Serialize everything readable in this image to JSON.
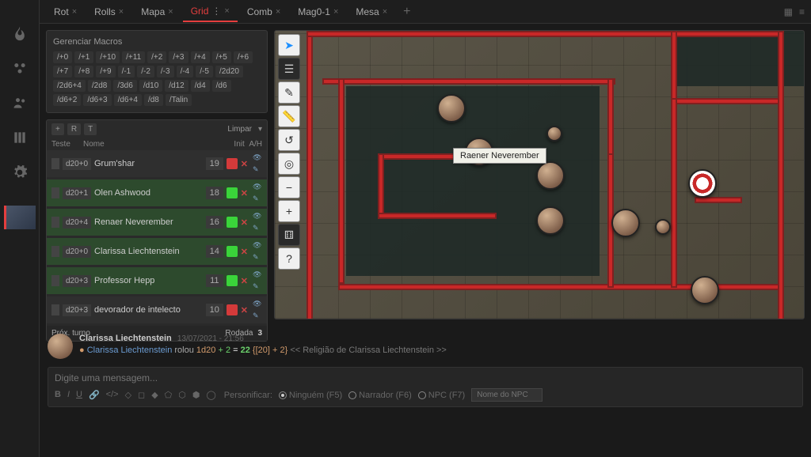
{
  "tabs": [
    "Rot",
    "Rolls",
    "Mapa",
    "Grid",
    "Comb",
    "Mag0-1",
    "Mesa"
  ],
  "activeTab": 3,
  "macros": {
    "title": "Gerenciar Macros",
    "items": [
      "/+0",
      "/+1",
      "/+10",
      "/+11",
      "/+2",
      "/+3",
      "/+4",
      "/+5",
      "/+6",
      "/+7",
      "/+8",
      "/+9",
      "/-1",
      "/-2",
      "/-3",
      "/-4",
      "/-5",
      "/2d20",
      "/2d6+4",
      "/2d8",
      "/3d6",
      "/d10",
      "/d12",
      "/d4",
      "/d6",
      "/d6+2",
      "/d6+3",
      "/d6+4",
      "/d8",
      "/Talin"
    ]
  },
  "initiative": {
    "buttons": {
      "r": "R",
      "t": "T",
      "clear": "Limpar"
    },
    "cols": {
      "test": "Teste",
      "name": "Nome",
      "init": "Init",
      "ah": "A/H"
    },
    "rows": [
      {
        "test": "d20+0",
        "name": "Grum'shar",
        "init": "19",
        "color": "#d43a3a",
        "player": false
      },
      {
        "test": "d20+1",
        "name": "Olen Ashwood",
        "init": "18",
        "color": "#3ad43a",
        "player": true
      },
      {
        "test": "d20+4",
        "name": "Renaer Neverember",
        "init": "16",
        "color": "#3ad43a",
        "player": true
      },
      {
        "test": "d20+0",
        "name": "Clarissa Liechtenstein",
        "init": "14",
        "color": "#3ad43a",
        "player": true
      },
      {
        "test": "d20+3",
        "name": "Professor Hepp",
        "init": "11",
        "color": "#3ad43a",
        "player": true
      },
      {
        "test": "d20+3",
        "name": "devorador de intelecto",
        "init": "10",
        "color": "#d43a3a",
        "player": false
      }
    ],
    "footer": {
      "next": "Próx. turno",
      "roundLabel": "Rodada",
      "round": "3"
    }
  },
  "map": {
    "tooltip": "Raener Neverember"
  },
  "chat": {
    "message": {
      "author": "Clarissa Liechtenstein",
      "ts": "13/07/2021 - 21:56",
      "actor": "Clarissa Liechtenstein",
      "rolledWord": "rolou",
      "dice": "1d20",
      "modPlus": " + ",
      "mod": "2",
      "eq": " = ",
      "total": "22",
      "detail": " {[20] + 2}",
      "context": "  << Religião de Clarissa Liechtenstein >>"
    },
    "placeholder": "Digite uma mensagem...",
    "impersonate": {
      "label": "Personificar:",
      "options": [
        "Ninguém (F5)",
        "Narrador (F6)",
        "NPC (F7)"
      ],
      "npcPlaceholder": "Nome do NPC"
    }
  }
}
